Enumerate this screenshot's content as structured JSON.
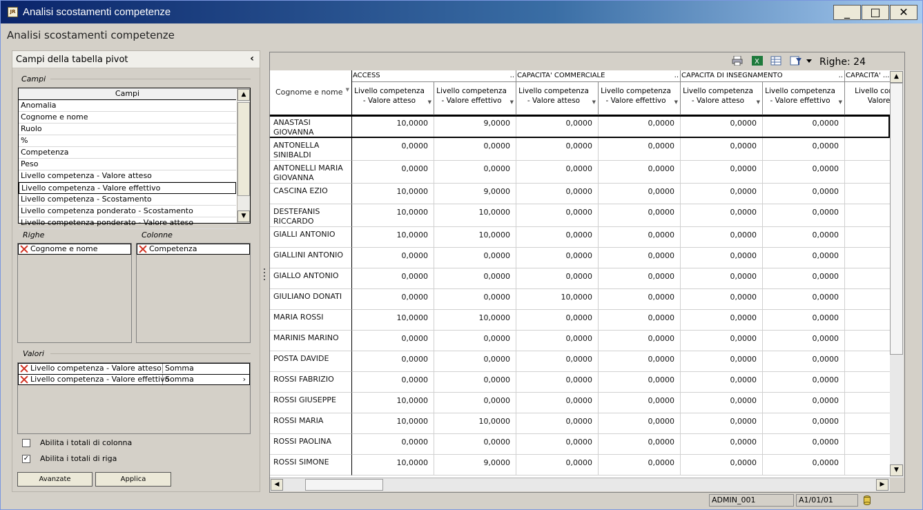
{
  "window": {
    "title": "Analisi scostamenti competenze",
    "icon_text": "JR",
    "minimize": "_",
    "maximize": "□",
    "close": "✕"
  },
  "app_title": "Analisi scostamenti competenze",
  "left_panel": {
    "header": "Campi della tabella pivot",
    "collapse": "‹",
    "campi_label": "Campi",
    "field_list_header": "Campi",
    "fields": [
      "Anomalia",
      "Cognome e nome",
      "Ruolo",
      "%",
      "Competenza",
      "Peso",
      "Livello competenza - Valore atteso",
      "Livello competenza - Valore effettivo",
      "Livello competenza - Scostamento",
      "Livello competenza ponderato - Scostamento",
      "Livello competenza ponderato - Valore atteso"
    ],
    "righe_label": "Righe",
    "righe_item": "Cognome e nome",
    "colonne_label": "Colonne",
    "colonne_item": "Competenza",
    "valori_label": "Valori",
    "valori": [
      {
        "name": "Livello competenza - Valore atteso",
        "agg": "Somma"
      },
      {
        "name": "Livello competenza - Valore effettivo",
        "agg": "Somma"
      }
    ],
    "check_col_totals": "Abilita i totali di colonna",
    "check_col_totals_mark": "",
    "check_row_totals": "Abilita i totali di riga",
    "check_row_totals_mark": "✓",
    "btn_advanced": "Avanzate",
    "btn_apply": "Applica"
  },
  "grid": {
    "righe": "Righe: 24",
    "row_header_title": "Cognome e nome",
    "groups": [
      "ACCESS",
      "CAPACITA' COMMERCIALE",
      "CAPACITA DI INSEGNAMENTO",
      "CAPACITA' ..."
    ],
    "sub_atteso": "Livello competenza - Valore atteso",
    "sub_effettivo": "Livello competenza - Valore effettivo",
    "sub_atteso_short": "Livello compe - Valore a",
    "rows": [
      {
        "name": "ANASTASI GIOVANNA",
        "v": [
          "10,0000",
          "9,0000",
          "0,0000",
          "0,0000",
          "0,0000",
          "0,0000"
        ]
      },
      {
        "name": "ANTONELLA SINIBALDI",
        "v": [
          "0,0000",
          "0,0000",
          "0,0000",
          "0,0000",
          "0,0000",
          "0,0000"
        ]
      },
      {
        "name": "ANTONELLI MARIA GIOVANNA",
        "v": [
          "0,0000",
          "0,0000",
          "0,0000",
          "0,0000",
          "0,0000",
          "0,0000"
        ]
      },
      {
        "name": "CASCINA EZIO",
        "v": [
          "10,0000",
          "9,0000",
          "0,0000",
          "0,0000",
          "0,0000",
          "0,0000"
        ]
      },
      {
        "name": "DESTEFANIS RICCARDO",
        "v": [
          "10,0000",
          "10,0000",
          "0,0000",
          "0,0000",
          "0,0000",
          "0,0000"
        ]
      },
      {
        "name": "GIALLI ANTONIO",
        "v": [
          "10,0000",
          "10,0000",
          "0,0000",
          "0,0000",
          "0,0000",
          "0,0000"
        ]
      },
      {
        "name": "GIALLINI ANTONIO",
        "v": [
          "0,0000",
          "0,0000",
          "0,0000",
          "0,0000",
          "0,0000",
          "0,0000"
        ]
      },
      {
        "name": "GIALLO ANTONIO",
        "v": [
          "0,0000",
          "0,0000",
          "0,0000",
          "0,0000",
          "0,0000",
          "0,0000"
        ]
      },
      {
        "name": "GIULIANO DONATI",
        "v": [
          "0,0000",
          "0,0000",
          "10,0000",
          "0,0000",
          "0,0000",
          "0,0000"
        ]
      },
      {
        "name": "MARIA ROSSI",
        "v": [
          "10,0000",
          "10,0000",
          "0,0000",
          "0,0000",
          "0,0000",
          "0,0000"
        ]
      },
      {
        "name": "MARINIS MARINO",
        "v": [
          "0,0000",
          "0,0000",
          "0,0000",
          "0,0000",
          "0,0000",
          "0,0000"
        ]
      },
      {
        "name": "POSTA DAVIDE",
        "v": [
          "0,0000",
          "0,0000",
          "0,0000",
          "0,0000",
          "0,0000",
          "0,0000"
        ]
      },
      {
        "name": "ROSSI FABRIZIO",
        "v": [
          "0,0000",
          "0,0000",
          "0,0000",
          "0,0000",
          "0,0000",
          "0,0000"
        ]
      },
      {
        "name": "ROSSI GIUSEPPE",
        "v": [
          "10,0000",
          "0,0000",
          "0,0000",
          "0,0000",
          "0,0000",
          "0,0000"
        ]
      },
      {
        "name": "ROSSI MARIA",
        "v": [
          "10,0000",
          "10,0000",
          "0,0000",
          "0,0000",
          "0,0000",
          "0,0000"
        ]
      },
      {
        "name": "ROSSI PAOLINA",
        "v": [
          "0,0000",
          "0,0000",
          "0,0000",
          "0,0000",
          "0,0000",
          "0,0000"
        ]
      },
      {
        "name": "ROSSI SIMONE",
        "v": [
          "10,0000",
          "9,0000",
          "0,0000",
          "0,0000",
          "0,0000",
          "0,0000"
        ]
      }
    ]
  },
  "status": {
    "user": "ADMIN_001",
    "code": "A1/01/01"
  }
}
